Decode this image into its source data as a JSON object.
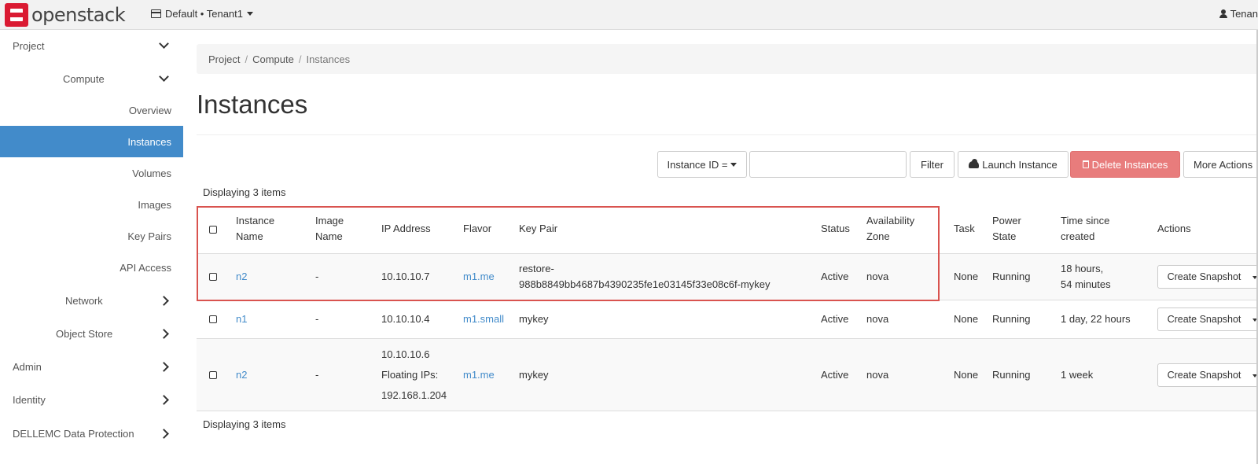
{
  "app": {
    "name": "openstack",
    "brand_color": "#da1a32",
    "accent_color": "#428bca",
    "danger_color": "#e87c7c"
  },
  "topbar": {
    "project_selector": "Default • Tenant1",
    "user_label": "Tenan"
  },
  "sidebar": {
    "project": "Project",
    "compute": "Compute",
    "items": [
      "Overview",
      "Instances",
      "Volumes",
      "Images",
      "Key Pairs",
      "API Access"
    ],
    "active": "Instances",
    "network": "Network",
    "object_store": "Object Store",
    "admin": "Admin",
    "identity": "Identity",
    "dellemc": "DELLEMC Data Protection"
  },
  "breadcrumb": [
    "Project",
    "Compute",
    "Instances"
  ],
  "page_title": "Instances",
  "toolbar": {
    "filter_field": "Instance ID =",
    "filter_value": "",
    "filter_button": "Filter",
    "launch_button": "Launch Instance",
    "delete_button": "Delete Instances",
    "more_button": "More Actions"
  },
  "displaying_text": "Displaying 3 items",
  "table": {
    "headers": {
      "name_1": "Instance",
      "name_2": "Name",
      "image_1": "Image",
      "image_2": "Name",
      "ip": "IP Address",
      "flavor": "Flavor",
      "keypair": "Key Pair",
      "status": "Status",
      "az_1": "Availability",
      "az_2": "Zone",
      "task": "Task",
      "power_1": "Power",
      "power_2": "State",
      "time_1": "Time since",
      "time_2": "created",
      "actions": "Actions"
    },
    "rows": [
      {
        "name": "n2",
        "image": "-",
        "ip": [
          "10.10.10.7"
        ],
        "flavor": "m1.me",
        "keypair": [
          "restore-",
          "988b8849bb4687b4390235fe1e03145f33e08c6f-mykey"
        ],
        "status": "Active",
        "az": "nova",
        "task": "None",
        "power": "Running",
        "time": [
          "18 hours,",
          "54 minutes"
        ],
        "action": "Create Snapshot"
      },
      {
        "name": "n1",
        "image": "-",
        "ip": [
          "10.10.10.4"
        ],
        "flavor": "m1.small",
        "keypair": [
          "mykey"
        ],
        "status": "Active",
        "az": "nova",
        "task": "None",
        "power": "Running",
        "time": [
          "1 day, 22 hours"
        ],
        "action": "Create Snapshot"
      },
      {
        "name": "n2",
        "image": "-",
        "ip": [
          "10.10.10.6",
          "Floating IPs:",
          "192.168.1.204"
        ],
        "flavor": "m1.me",
        "keypair": [
          "mykey"
        ],
        "status": "Active",
        "az": "nova",
        "task": "None",
        "power": "Running",
        "time": [
          "1 week"
        ],
        "action": "Create Snapshot"
      }
    ]
  }
}
